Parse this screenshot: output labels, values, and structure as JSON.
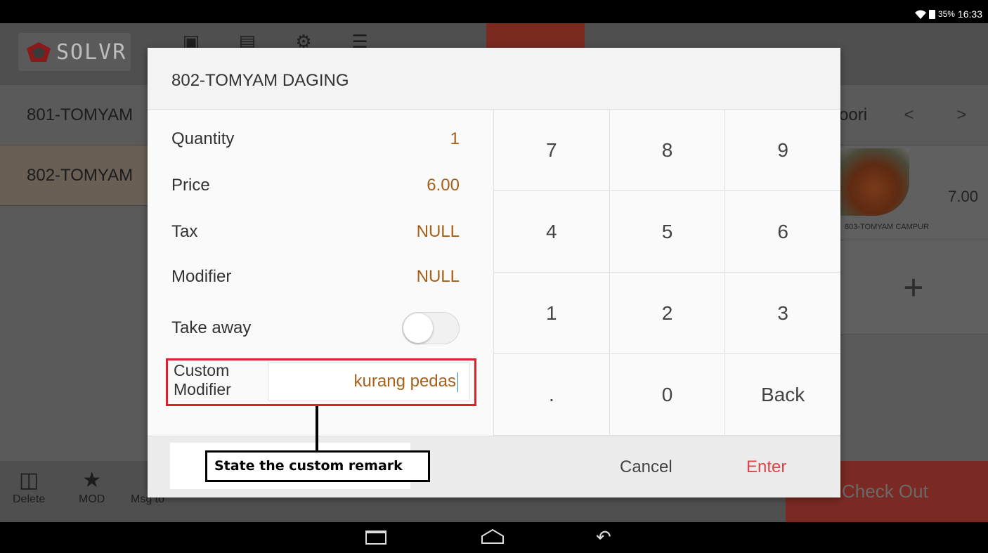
{
  "status_bar": {
    "battery": "35%",
    "time": "16:33"
  },
  "brand": {
    "logo_text": "SOLVR"
  },
  "order_list": {
    "items": [
      {
        "label": "801-TOMYAM"
      },
      {
        "label": "802-TOMYAM"
      }
    ]
  },
  "right_panel": {
    "category": "oori",
    "prev": "<",
    "next": ">",
    "item": {
      "price": "7.00",
      "name": "803-TOMYAM CAMPUR"
    },
    "add": "+"
  },
  "bottom_bar": {
    "delete": "Delete",
    "mod": "MOD",
    "msg": "Msg to",
    "checkout": "Check Out"
  },
  "dialog": {
    "title": "802-TOMYAM DAGING",
    "fields": {
      "quantity_label": "Quantity",
      "quantity_value": "1",
      "price_label": "Price",
      "price_value": "6.00",
      "tax_label": "Tax",
      "tax_value": "NULL",
      "modifier_label": "Modifier",
      "modifier_value": "NULL",
      "takeaway_label": "Take away",
      "takeaway_on": false,
      "custom_label_line1": "Custom",
      "custom_label_line2": "Modifier",
      "custom_value": "kurang pedas"
    },
    "keypad": [
      "7",
      "8",
      "9",
      "4",
      "5",
      "6",
      "1",
      "2",
      "3",
      ".",
      "0",
      "Back"
    ],
    "cancel": "Cancel",
    "enter": "Enter"
  },
  "annotation": {
    "text": "State the custom remark"
  },
  "colors": {
    "accent_value": "#a86018",
    "enter": "#e0434a",
    "highlight": "#e0202a"
  }
}
